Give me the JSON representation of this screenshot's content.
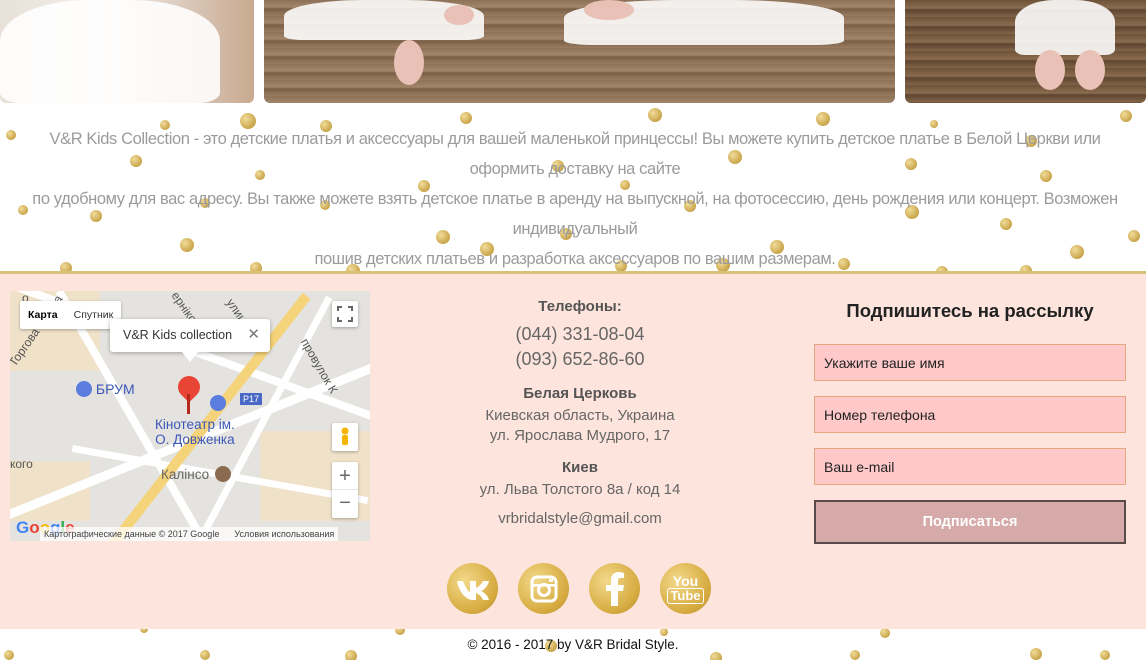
{
  "description": {
    "line1": "V&R Kids Collection - это детские платья и аксессуары для вашей маленькой принцессы! Вы можете купить детское платье в Белой Церкви или оформить доставку на сайте",
    "line2": "по удобному для вас адресу. Вы также можете взять детское платье в аренду на выпускной, на фотосессию, день рождения или концерт. Возможен индивидуальный",
    "line3": "пошив детских платьев и разработка аксессуаров по вашим размерам."
  },
  "map": {
    "tab_map": "Карта",
    "tab_satellite": "Спутник",
    "info_title": "V&R Kids collection",
    "info_close": "✕",
    "labels": {
      "brum": "БРУМ",
      "cinema_line1": "Кінотеатр ім.",
      "cinema_line2": "О. Довженка",
      "kalinco": "Калінсо",
      "p17": "P17",
      "torgova": "Торгова площа",
      "proviluk": "провулок К",
      "iogo": "кого",
      "ulitsa": "улиця",
      "nikolaieva": "ерніко",
      "o": "о"
    },
    "zoom_in": "+",
    "zoom_out": "−",
    "footer_data": "Картографические данные © 2017 Google",
    "footer_terms": "Условия использования",
    "google_logo": "Google"
  },
  "contacts": {
    "phones_heading": "Телефоны:",
    "phone1": "(044) 331-08-04",
    "phone2": "(093) 652-86-60",
    "city1": "Белая Церковь",
    "city1_line1": "Киевская область, Украина",
    "city1_line2": "ул. Ярослава Мудрого, 17",
    "city2": "Киев",
    "city2_line1": "ул. Льва Толстого 8а / код 14",
    "email": "vrbridalstyle@gmail.com"
  },
  "subscribe": {
    "title": "Подпишитесь на рассылку",
    "name_placeholder": "Укажите ваше имя",
    "phone_placeholder": "Номер телефона",
    "email_placeholder": "Ваш e-mail",
    "button": "Подписаться"
  },
  "social": {
    "vk": "vk-icon",
    "instagram": "instagram-icon",
    "facebook": "facebook-icon",
    "youtube_line1": "You",
    "youtube_line2": "Tube"
  },
  "footer": {
    "copyright": "© 2016 - 2017 by V&R Bridal Style."
  },
  "colors": {
    "footer_bg": "#fde4dc",
    "input_bg": "#ffc9c9",
    "button_bg": "#d5aaa9",
    "gold": "#d7ac42"
  }
}
